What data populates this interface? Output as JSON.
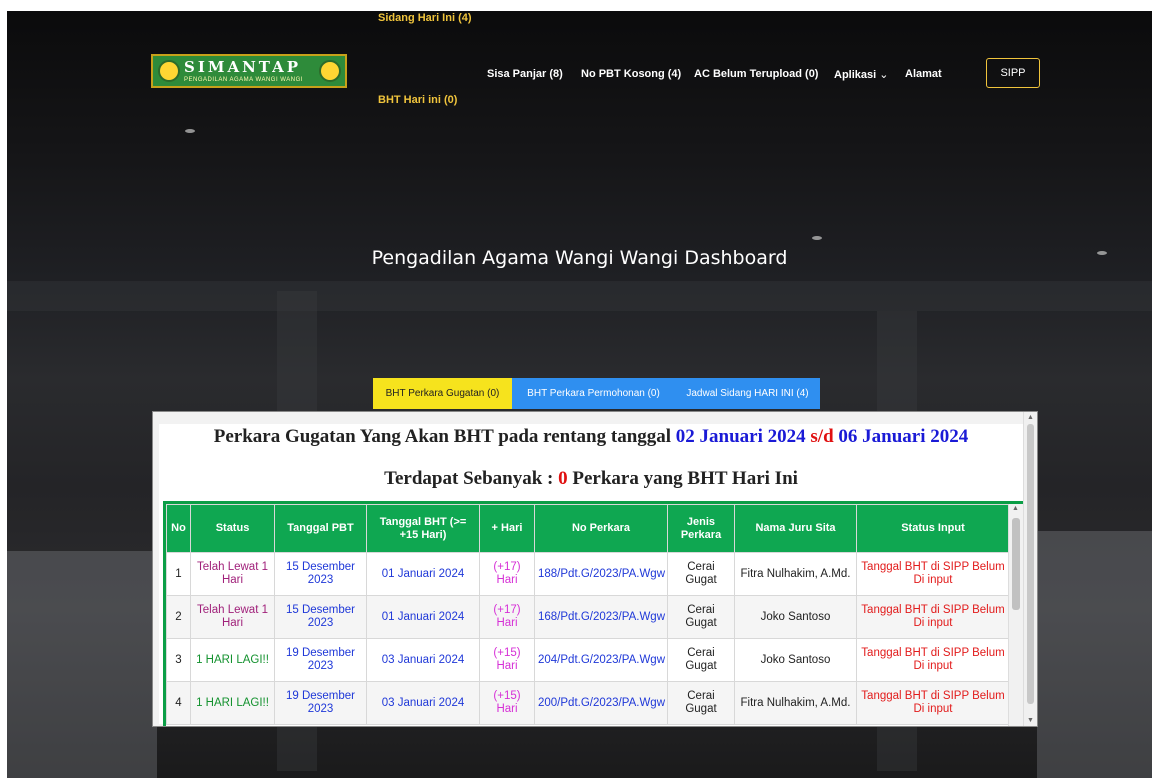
{
  "logo": {
    "title": "SIMANTAP",
    "subtitle": "PENGADILAN AGAMA WANGI WANGI"
  },
  "nav": {
    "sidang_hari_ini": "Sidang Hari Ini  (4)",
    "bht_hari_ini": "BHT Hari ini    (0)",
    "sisa_panjar": "Sisa Panjar  (8)",
    "no_pbt_kosong": "No PBT Kosong  (4)",
    "ac_belum": "AC Belum Terupload  (0)",
    "aplikasi": "Aplikasi",
    "alamat": "Alamat",
    "sipp": "SIPP"
  },
  "hero_title": "Pengadilan Agama Wangi Wangi Dashboard",
  "tabs": [
    {
      "label": "BHT Perkara Gugatan (0)"
    },
    {
      "label": "BHT Perkara Permohonan (0)"
    },
    {
      "label": "Jadwal Sidang HARI INI (4)"
    }
  ],
  "heading": {
    "prefix": "Perkara Gugatan Yang Akan BHT pada rentang tanggal ",
    "date_from": "02 Januari 2024",
    "sd": " s/d ",
    "date_to": "06 Januari 2024",
    "count_prefix": "Terdapat Sebanyak : ",
    "count": "0",
    "count_suffix": " Perkara yang BHT Hari Ini"
  },
  "table": {
    "headers": [
      "No",
      "Status",
      "Tanggal PBT",
      "Tanggal BHT (>= +15 Hari)",
      "+ Hari",
      "No Perkara",
      "Jenis Perkara",
      "Nama Juru Sita",
      "Status Input"
    ],
    "rows": [
      {
        "no": "1",
        "status": "Telah Lewat 1 Hari",
        "tgl_pbt": "15 Desember 2023",
        "tgl_bht": "01 Januari 2024",
        "plus": "(+17) Hari",
        "no_perkara": "188/Pdt.G/2023/PA.Wgw",
        "jenis": "Cerai Gugat",
        "juru_sita": "Fitra Nulhakim, A.Md.",
        "status_input": "Tanggal BHT di SIPP Belum Di input"
      },
      {
        "no": "2",
        "status": "Telah Lewat 1 Hari",
        "tgl_pbt": "15 Desember 2023",
        "tgl_bht": "01 Januari 2024",
        "plus": "(+17) Hari",
        "no_perkara": "168/Pdt.G/2023/PA.Wgw",
        "jenis": "Cerai Gugat",
        "juru_sita": "Joko Santoso",
        "status_input": "Tanggal BHT di SIPP Belum Di input"
      },
      {
        "no": "3",
        "status": "1 HARI LAGI!!",
        "tgl_pbt": "19 Desember 2023",
        "tgl_bht": "03 Januari 2024",
        "plus": "(+15) Hari",
        "no_perkara": "204/Pdt.G/2023/PA.Wgw",
        "jenis": "Cerai Gugat",
        "juru_sita": "Joko Santoso",
        "status_input": "Tanggal BHT di SIPP Belum Di input"
      },
      {
        "no": "4",
        "status": "1 HARI LAGI!!",
        "tgl_pbt": "19 Desember 2023",
        "tgl_bht": "03 Januari 2024",
        "plus": "(+15) Hari",
        "no_perkara": "200/Pdt.G/2023/PA.Wgw",
        "jenis": "Cerai Gugat",
        "juru_sita": "Fitra Nulhakim, A.Md.",
        "status_input": "Tanggal BHT di SIPP Belum Di input"
      }
    ]
  },
  "colors": {
    "green_header": "#0fa751",
    "tab_yellow": "#f6e31d",
    "tab_blue": "#2f8ff0",
    "gold": "#f0c43c"
  }
}
